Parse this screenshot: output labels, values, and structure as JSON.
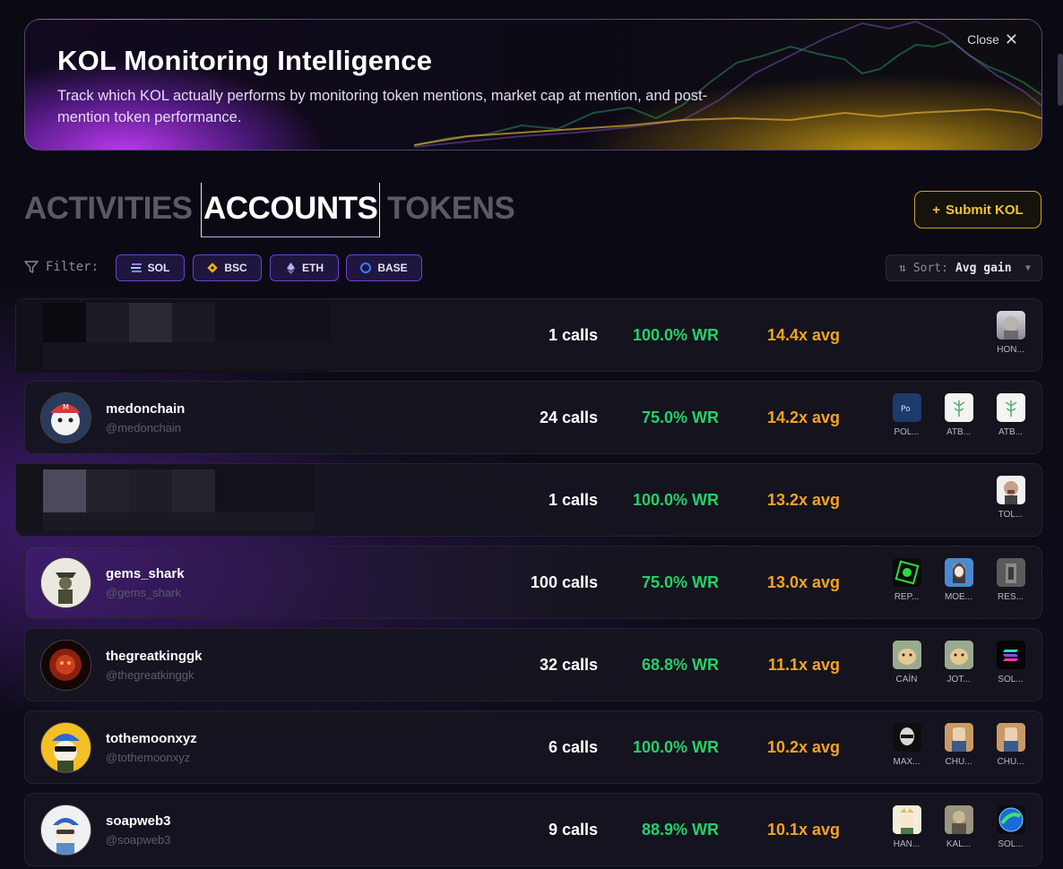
{
  "banner": {
    "title": "KOL Monitoring Intelligence",
    "description": "Track which KOL actually performs by monitoring token mentions, market cap at mention, and post-mention token performance.",
    "close_label": "Close"
  },
  "tabs": [
    {
      "label": "ACTIVITIES",
      "active": false
    },
    {
      "label": "ACCOUNTS",
      "active": true
    },
    {
      "label": "TOKENS",
      "active": false
    }
  ],
  "submit_button": {
    "label": "Submit KOL",
    "icon": "plus-icon"
  },
  "filter": {
    "label": "Filter:",
    "chips": [
      {
        "label": "SOL",
        "icon": "solana-icon"
      },
      {
        "label": "BSC",
        "icon": "bnb-icon"
      },
      {
        "label": "ETH",
        "icon": "ethereum-icon"
      },
      {
        "label": "BASE",
        "icon": "base-icon"
      }
    ]
  },
  "sort": {
    "label": "Sort:",
    "value": "Avg gain"
  },
  "colors": {
    "win_rate": "#25d06a",
    "avg_gain": "#f5a31e",
    "accent": "#6a3fd0",
    "submit": "#f0c52a"
  },
  "accounts": [
    {
      "name": "",
      "handle": "",
      "calls": "1 calls",
      "win_rate": "100.0% WR",
      "avg_gain": "14.4x avg",
      "tokens": [
        "HON..."
      ]
    },
    {
      "name": "medonchain",
      "handle": "@medonchain",
      "calls": "24 calls",
      "win_rate": "75.0% WR",
      "avg_gain": "14.2x avg",
      "tokens": [
        "POL...",
        "ATB...",
        "ATB..."
      ]
    },
    {
      "name": "",
      "handle": "",
      "calls": "1 calls",
      "win_rate": "100.0% WR",
      "avg_gain": "13.2x avg",
      "tokens": [
        "TOL..."
      ]
    },
    {
      "name": "gems_shark",
      "handle": "@gems_shark",
      "calls": "100 calls",
      "win_rate": "75.0% WR",
      "avg_gain": "13.0x avg",
      "tokens": [
        "REP...",
        "MOE...",
        "RES..."
      ]
    },
    {
      "name": "thegreatkinggk",
      "handle": "@thegreatkinggk",
      "calls": "32 calls",
      "win_rate": "68.8% WR",
      "avg_gain": "11.1x avg",
      "tokens": [
        "CAÍN",
        "JOT...",
        "SOL..."
      ]
    },
    {
      "name": "tothemoonxyz",
      "handle": "@tothemoonxyz",
      "calls": "6 calls",
      "win_rate": "100.0% WR",
      "avg_gain": "10.2x avg",
      "tokens": [
        "MAX...",
        "CHU...",
        "CHU..."
      ]
    },
    {
      "name": "soapweb3",
      "handle": "@soapweb3",
      "calls": "9 calls",
      "win_rate": "88.9% WR",
      "avg_gain": "10.1x avg",
      "tokens": [
        "HAN...",
        "KAL...",
        "SOL..."
      ]
    }
  ]
}
